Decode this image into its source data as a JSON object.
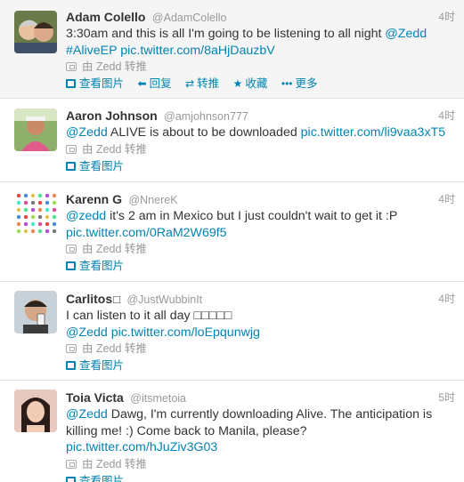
{
  "labels": {
    "view_photo": "查看图片",
    "reply": "回复",
    "retweet": "转推",
    "favorite": "收藏",
    "more": "更多",
    "retweeted_by": "由 Zedd 转推"
  },
  "icons": {
    "view_photo": "photo-icon",
    "reply": "reply-arrow-icon",
    "retweet": "retweet-arrows-icon",
    "favorite": "star-icon",
    "more": "ellipsis-icon",
    "retweeted": "retweet-small-icon"
  },
  "colors": {
    "link": "#0084b4",
    "muted": "#999999",
    "text": "#333333",
    "hover_bg": "#f5f5f5"
  },
  "tweets": [
    {
      "name": "Adam Colello",
      "handle": "@AdamColello",
      "time": "4时",
      "text": "3:30am and this is all I'm going to be listening to all night ",
      "mention": "@Zedd",
      "hashtag": "#AliveEP",
      "link": "pic.twitter.com/8aHjDauzbV"
    },
    {
      "name": "Aaron Johnson",
      "handle": "@amjohnson777",
      "time": "4时",
      "mention": "@Zedd",
      "text": " ALIVE is about to be downloaded ",
      "link": "pic.twitter.com/li9vaa3xT5"
    },
    {
      "name": "Karenn G",
      "handle": "@NnereK",
      "time": "4时",
      "mention": "@zedd",
      "text": " it's 2 am in Mexico but I just couldn't wait to get it :P",
      "link": "pic.twitter.com/0RaM2W69f5"
    },
    {
      "name": "Carlitos",
      "flag": "□",
      "handle": "@JustWubbinIt",
      "time": "4时",
      "text": "I can listen to it all day □□□□□",
      "mention": "@Zedd",
      "link": "pic.twitter.com/loEpqunwjg"
    },
    {
      "name": "Toia Victa",
      "handle": "@itsmetoia",
      "time": "5时",
      "mention": "@Zedd",
      "text": " Dawg, I'm currently downloading Alive. The anticipation is killing me! :) Come back to Manila, please?",
      "link": "pic.twitter.com/hJuZiv3G03"
    }
  ]
}
